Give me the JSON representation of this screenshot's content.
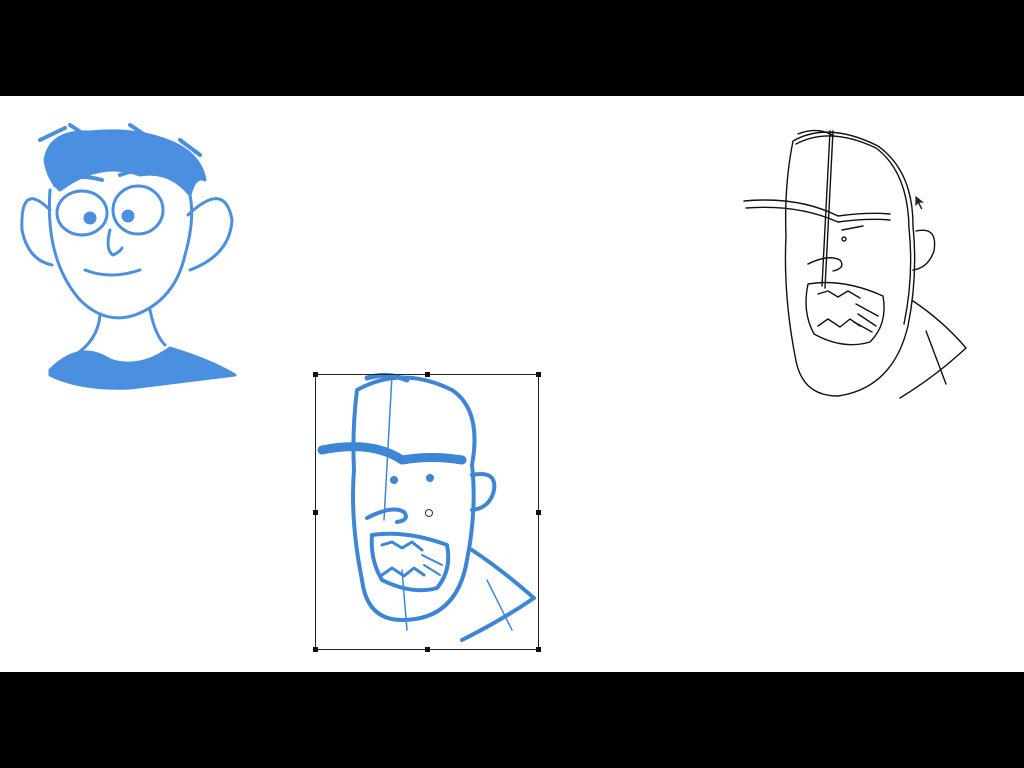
{
  "canvas": {
    "background": "#ffffff",
    "letterbox_color": "#000000"
  },
  "sketches": [
    {
      "name": "blue-sketch-boy-head",
      "color": "#4a8fe0",
      "selected": false
    },
    {
      "name": "blue-sketch-brute-head",
      "color": "#3d86d6",
      "selected": true
    },
    {
      "name": "outline-sketch-brute-head",
      "color": "#000000",
      "selected": false
    }
  ],
  "tools": {
    "active": "transform-selection",
    "cursor_icon": "arrow-cursor-icon"
  }
}
